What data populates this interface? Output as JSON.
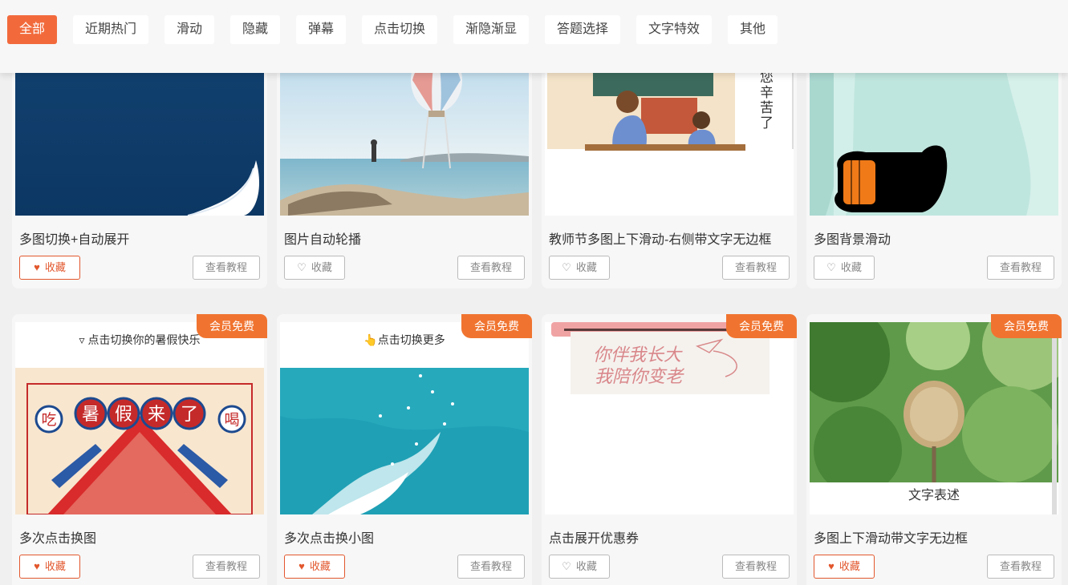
{
  "filters": [
    {
      "label": "全部",
      "active": true
    },
    {
      "label": "近期热门",
      "active": false
    },
    {
      "label": "滑动",
      "active": false
    },
    {
      "label": "隐藏",
      "active": false
    },
    {
      "label": "弹幕",
      "active": false
    },
    {
      "label": "点击切换",
      "active": false
    },
    {
      "label": "渐隐渐显",
      "active": false
    },
    {
      "label": "答题选择",
      "active": false
    },
    {
      "label": "文字特效",
      "active": false
    },
    {
      "label": "其他",
      "active": false
    }
  ],
  "labels": {
    "favorite": "收藏",
    "tutorial": "查看教程",
    "vip": "会员免费"
  },
  "cards": [
    {
      "title": "多图切换+自动展开",
      "favorited": true,
      "vip": false
    },
    {
      "title": "图片自动轮播",
      "favorited": false,
      "vip": false
    },
    {
      "title": "教师节多图上下滑动-右侧带文字无边框",
      "favorited": false,
      "vip": false,
      "side_text": "您辛苦了"
    },
    {
      "title": "多图背景滑动",
      "favorited": false,
      "vip": false
    },
    {
      "title": "多次点击换图",
      "favorited": true,
      "vip": true,
      "top_caption": "▿ 点击切换你的暑假快乐",
      "poster_chars": [
        "吃",
        "暑",
        "假",
        "来",
        "了",
        "喝"
      ]
    },
    {
      "title": "多次点击换小图",
      "favorited": true,
      "vip": true,
      "top_caption": "👆点击切换更多"
    },
    {
      "title": "点击展开优惠券",
      "favorited": false,
      "vip": true,
      "handwriting": [
        "你伴我长大",
        "我陪你变老"
      ]
    },
    {
      "title": "多图上下滑动带文字无边框",
      "favorited": true,
      "vip": true,
      "bottom_caption": "文字表述"
    }
  ],
  "colors": {
    "accent": "#f26a3c",
    "vip": "#f07430",
    "favorite": "#e2572d"
  }
}
